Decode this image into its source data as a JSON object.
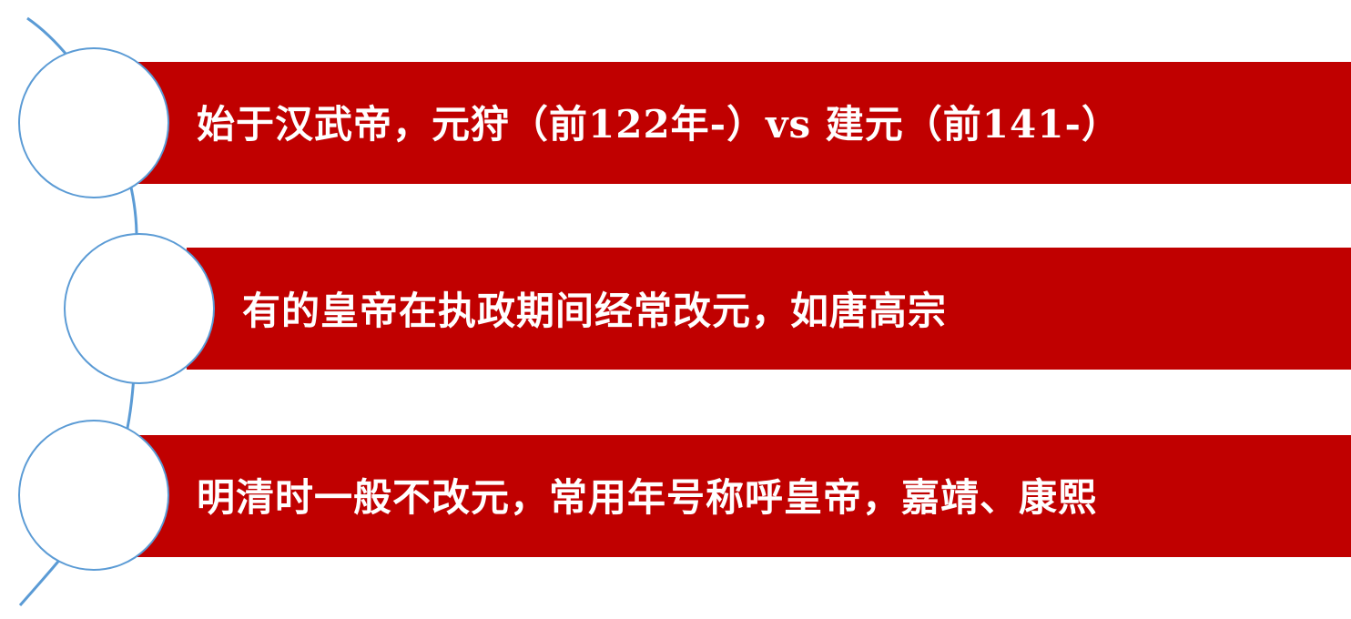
{
  "items": [
    {
      "text": "始于汉武帝，元狩（前122年-）vs 建元（前141-）"
    },
    {
      "text": "有的皇帝在执政期间经常改元，如唐高宗"
    },
    {
      "text": "明清时一般不改元，常用年号称呼皇帝，嘉靖、康熙"
    }
  ],
  "colors": {
    "band": "#c00000",
    "band_text": "#ffffff",
    "node_fill": "#ffffff",
    "node_border": "#5b9bd5",
    "arc": "#5b9bd5"
  }
}
